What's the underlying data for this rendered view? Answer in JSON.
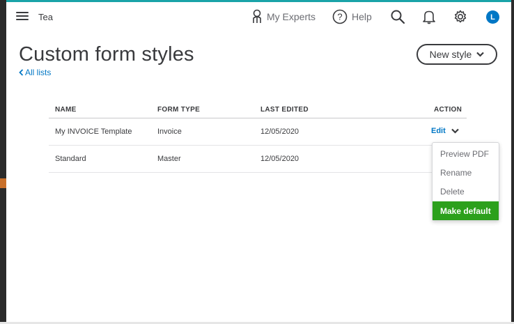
{
  "topbar": {
    "company": "Tea",
    "experts_label": "My Experts",
    "help_label": "Help",
    "avatar_initial": "L"
  },
  "page": {
    "title": "Custom form styles",
    "back_link": "All lists",
    "new_style_label": "New style"
  },
  "table": {
    "headers": [
      "NAME",
      "FORM TYPE",
      "LAST EDITED",
      "ACTION"
    ],
    "rows": [
      {
        "name": "My INVOICE Template",
        "form_type": "Invoice",
        "last_edited": "12/05/2020",
        "action": "Edit"
      },
      {
        "name": "Standard",
        "form_type": "Master",
        "last_edited": "12/05/2020",
        "action": ""
      }
    ]
  },
  "action_menu": {
    "items": [
      "Preview PDF",
      "Rename",
      "Delete",
      "Make default"
    ]
  },
  "colors": {
    "link": "#0077c5",
    "primary_green": "#2ca01c",
    "text": "#393a3d",
    "frame_teal": "#1aa3a8"
  }
}
